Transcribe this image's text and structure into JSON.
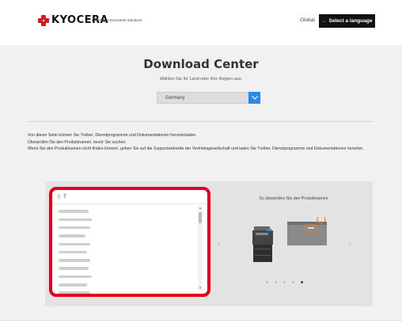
{
  "header": {
    "brand": "KYOCERA",
    "sub_brand": "KYOCERA Document Solutions",
    "global_link": "Global",
    "language_button": "Select a language",
    "language_button_icon": "arrow-right-icon"
  },
  "main": {
    "title": "Download Center",
    "subtitle": "Wählen Sie Ihr Land oder Ihre Region aus.",
    "country_select": {
      "value": "Germany",
      "icon": "chevron-down-icon"
    },
    "info_lines": [
      "Von dieser Seite können Sie Treiber, Dienstprogramme und Dokumentationen herunterladen.",
      "Überprüfen Sie den Produktnamen, bevor Sie suchen.",
      "Wenn Sie den Produktnamen nicht finden können, gehen Sie auf die Supportwebseite der Vertriebsgesellschaft und laden Sie Treiber, Dienstprogramme und Dokumentationen herunter."
    ]
  },
  "search": {
    "value": "T",
    "icon": "search-icon",
    "results_count_visible": 12
  },
  "carousel": {
    "title": "So überprüfen Sie den Produktnamen",
    "prev": "‹",
    "next": "›",
    "slides": 5,
    "active_slide": 5
  },
  "colors": {
    "accent_blue": "#2a8be6",
    "highlight_red": "#e3001f",
    "brand_red": "#d71920"
  }
}
